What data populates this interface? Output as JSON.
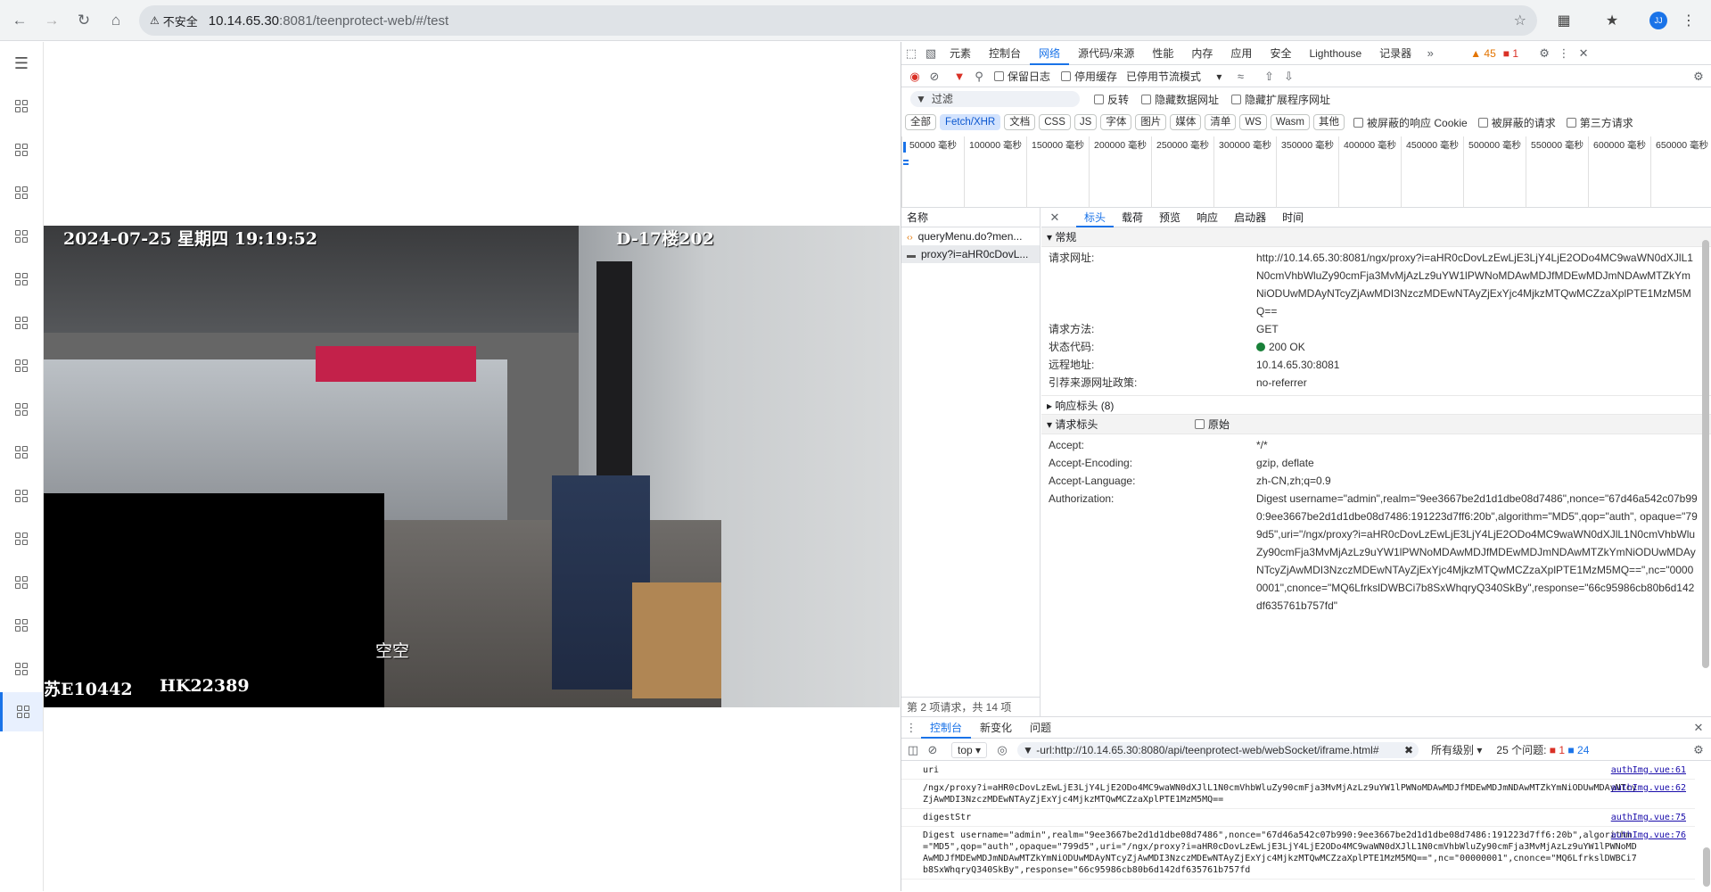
{
  "browser": {
    "security_label": "不安全",
    "url_host": "10.14.65.30",
    "url_path": ":8081/teenprotect-web/#/test",
    "avatar_initial": "JJ"
  },
  "video": {
    "timestamp": "2024-07-25 星期四 19:19:52",
    "location": "D-17楼202",
    "overlay_mid": "空空",
    "overlay_left": "苏E10442",
    "overlay_right": "HK22389"
  },
  "devtools": {
    "tabs": [
      "元素",
      "控制台",
      "网络",
      "源代码/来源",
      "性能",
      "内存",
      "应用",
      "安全",
      "Lighthouse",
      "记录器"
    ],
    "active_tab": "网络",
    "warnings": "45",
    "errors": "1",
    "toolbar": {
      "preserve_log": "保留日志",
      "disable_cache": "停用缓存",
      "throttle": "已停用节流模式"
    },
    "filter": {
      "placeholder": "过滤",
      "invert": "反转",
      "hide_data_urls": "隐藏数据网址",
      "hide_ext_urls": "隐藏扩展程序网址"
    },
    "type_filters": [
      "全部",
      "Fetch/XHR",
      "文档",
      "CSS",
      "JS",
      "字体",
      "图片",
      "媒体",
      "清单",
      "WS",
      "Wasm",
      "其他"
    ],
    "active_type": "Fetch/XHR",
    "blocked_cookies": "被屏蔽的响应 Cookie",
    "blocked_requests": "被屏蔽的请求",
    "third_party": "第三方请求",
    "timeline_ticks": [
      "50000 毫秒",
      "100000 毫秒",
      "150000 毫秒",
      "200000 毫秒",
      "250000 毫秒",
      "300000 毫秒",
      "350000 毫秒",
      "400000 毫秒",
      "450000 毫秒",
      "500000 毫秒",
      "550000 毫秒",
      "600000 毫秒",
      "650000 毫秒"
    ],
    "name_header": "名称",
    "requests": [
      "queryMenu.do?men...",
      "proxy?i=aHR0cDovL..."
    ],
    "request_summary": "第 2 项请求，共 14 项",
    "detail_tabs": [
      "标头",
      "载荷",
      "预览",
      "响应",
      "启动器",
      "时间"
    ],
    "active_detail_tab": "标头",
    "general": {
      "title": "常规",
      "rows": [
        {
          "k": "请求网址:",
          "v": "http://10.14.65.30:8081/ngx/proxy?i=aHR0cDovLzEwLjE3LjY4LjE2ODo4MC9waWN0dXJlL1N0cmVhbWluZy90cmFja3MvMjAzLz9uYW1lPWNoMDAwMDJfMDEwMDJmNDAwMTZkYmNiODUwMDAyNTcyZjAwMDI3NzczMDEwNTAyZjExYjc4MjkzMTQwMCZzaXplPTE1MzM5MQ=="
        },
        {
          "k": "请求方法:",
          "v": "GET"
        },
        {
          "k": "状态代码:",
          "v": "200 OK"
        },
        {
          "k": "远程地址:",
          "v": "10.14.65.30:8081"
        },
        {
          "k": "引荐来源网址政策:",
          "v": "no-referrer"
        }
      ]
    },
    "response_headers": "响应标头 (8)",
    "request_headers": {
      "title": "请求标头",
      "raw_label": "原始",
      "rows": [
        {
          "k": "Accept:",
          "v": "*/*"
        },
        {
          "k": "Accept-Encoding:",
          "v": "gzip, deflate"
        },
        {
          "k": "Accept-Language:",
          "v": "zh-CN,zh;q=0.9"
        },
        {
          "k": "Authorization:",
          "v": "Digest username=\"admin\",realm=\"9ee3667be2d1d1dbe08d7486\",nonce=\"67d46a542c07b990:9ee3667be2d1d1dbe08d7486:191223d7ff6:20b\",algorithm=\"MD5\",qop=\"auth\", opaque=\"799d5\",uri=\"/ngx/proxy?i=aHR0cDovLzEwLjE3LjY4LjE2ODo4MC9waWN0dXJlL1N0cmVhbWluZy90cmFja3MvMjAzLz9uYW1lPWNoMDAwMDJfMDEwMDJmNDAwMTZkYmNiODUwMDAyNTcyZjAwMDI3NzczMDEwNTAyZjExYjc4MjkzMTQwMCZzaXplPTE1MzM5MQ==\",nc=\"00000001\",cnonce=\"MQ6LfrkslDWBCi7b8SxWhqryQ340SkBy\",response=\"66c95986cb80b6d142df635761b757fd\""
        }
      ]
    },
    "drawer_tabs": [
      "控制台",
      "新变化",
      "问题"
    ],
    "active_drawer_tab": "控制台",
    "console_context": "top",
    "console_filter": "-url:http://10.14.65.30:8080/api/teenprotect-web/webSocket/iframe.html#",
    "levels": "所有级别",
    "issues": "25 个问题:",
    "issue_errors": "1",
    "issue_info": "24",
    "logs": [
      {
        "text": "uri",
        "src": "authImg.vue:61"
      },
      {
        "text": "/ngx/proxy?i=aHR0cDovLzEwLjE3LjY4LjE2ODo4MC9waWN0dXJlL1N0cmVhbWluZy90cmFja3MvMjAzLz9uYW1lPWNoMDAwMDJfMDEwMDJmNDAwMTZkYmNiODUwMDAyNTcyZjAwMDI3NzczMDEwNTAyZjExYjc4MjkzMTQwMCZzaXplPTE1MzM5MQ==",
        "src": "authImg.vue:62"
      },
      {
        "text": "digestStr",
        "src": "authImg.vue:75"
      },
      {
        "text": "Digest username=\"admin\",realm=\"9ee3667be2d1d1dbe08d7486\",nonce=\"67d46a542c07b990:9ee3667be2d1d1dbe08d7486:191223d7ff6:20b\",algorithm=\"MD5\",qop=\"auth\",opaque=\"799d5\",uri=\"/ngx/proxy?i=aHR0cDovLzEwLjE3LjY4LjE2ODo4MC9waWN0dXJlL1N0cmVhbWluZy90cmFja3MvMjAzLz9uYW1lPWNoMDAwMDJfMDEwMDJmNDAwMTZkYmNiODUwMDAyNTcyZjAwMDI3NzczMDEwNTAyZjExYjc4MjkzMTQwMCZzaXplPTE1MzM5MQ==\",nc=\"00000001\",cnonce=\"MQ6LfrkslDWBCi7b8SxWhqryQ340SkBy\",response=\"66c95986cb80b6d142df635761b757fd",
        "src": "authImg.vue:76"
      }
    ]
  }
}
